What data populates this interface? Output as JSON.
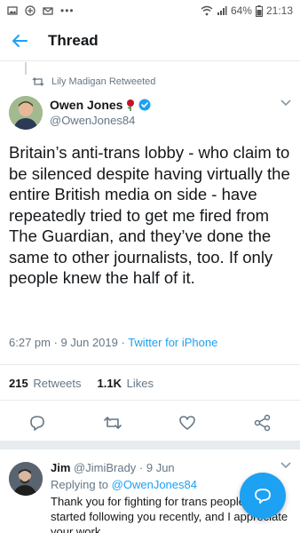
{
  "statusbar": {
    "left_icons": [
      "gallery-icon",
      "vpn-icon",
      "mail-icon",
      "more-icon"
    ],
    "more": "•••",
    "battery": "64%",
    "time": "21:13"
  },
  "appbar": {
    "title": "Thread"
  },
  "tweet": {
    "retweeted_by": "Lily Madigan Retweeted",
    "author_name": "Owen Jones",
    "author_handle": "@OwenJones84",
    "text": "Britain’s anti-trans lobby - who claim to be silenced despite having virtually the entire British media on side - have repeatedly tried to get me fired from The Guardian, and they’ve done the same to other journalists, too. If only people knew the half of it.",
    "time": "6:27 pm · 9 Jun 2019 · ",
    "source": "Twitter for iPhone",
    "retweets_count": "215",
    "retweets_label": "Retweets",
    "likes_count": "1.1K",
    "likes_label": "Likes"
  },
  "reply": {
    "name": "Jim",
    "handle": "@JimiBrady",
    "date": "· 9 Jun",
    "replying_label": "Replying to ",
    "replying_to": "@OwenJones84",
    "text": "Thank you for fighting for trans people. I started following you recently, and I appreciate your work."
  },
  "colors": {
    "accent": "#1da1f2",
    "rose": "#c0142a",
    "muted": "#657786"
  }
}
